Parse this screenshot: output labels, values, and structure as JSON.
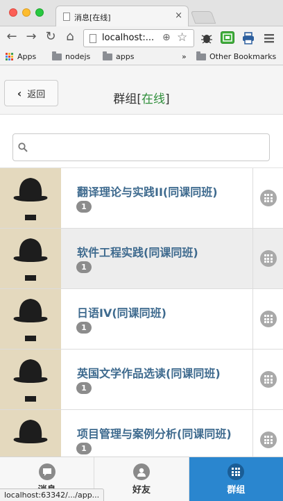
{
  "browser": {
    "tab_title": "消息[在线]",
    "tab_close": "×",
    "url": "localhost:...",
    "status_url": "localhost:63342/.../app..."
  },
  "bookmarks": {
    "items": [
      "Apps",
      "nodejs",
      "apps"
    ],
    "overflow": "»",
    "other": "Other Bookmarks"
  },
  "header": {
    "back_label": "返回",
    "title": "群组",
    "status_open": "[",
    "status": "在线",
    "status_close": "]"
  },
  "search": {
    "value": "",
    "placeholder": ""
  },
  "groups": [
    {
      "name": "翻译理论与实践II(同课同班)",
      "badge": "1"
    },
    {
      "name": "软件工程实践(同课同班)",
      "badge": "1"
    },
    {
      "name": "日语IV(同课同班)",
      "badge": "1"
    },
    {
      "name": "英国文学作品选读(同课同班)",
      "badge": "1"
    },
    {
      "name": "项目管理与案例分析(同课同班)",
      "badge": "1"
    }
  ],
  "tabbar": [
    {
      "label": "消息",
      "icon": "chat-icon"
    },
    {
      "label": "好友",
      "icon": "user-icon"
    },
    {
      "label": "群组",
      "icon": "grid-icon",
      "active": true
    }
  ],
  "colors": {
    "accent": "#2a86cf",
    "group_name": "#3e6a8e",
    "online": "#2f8e3a",
    "badge": "#8c8c8c"
  }
}
